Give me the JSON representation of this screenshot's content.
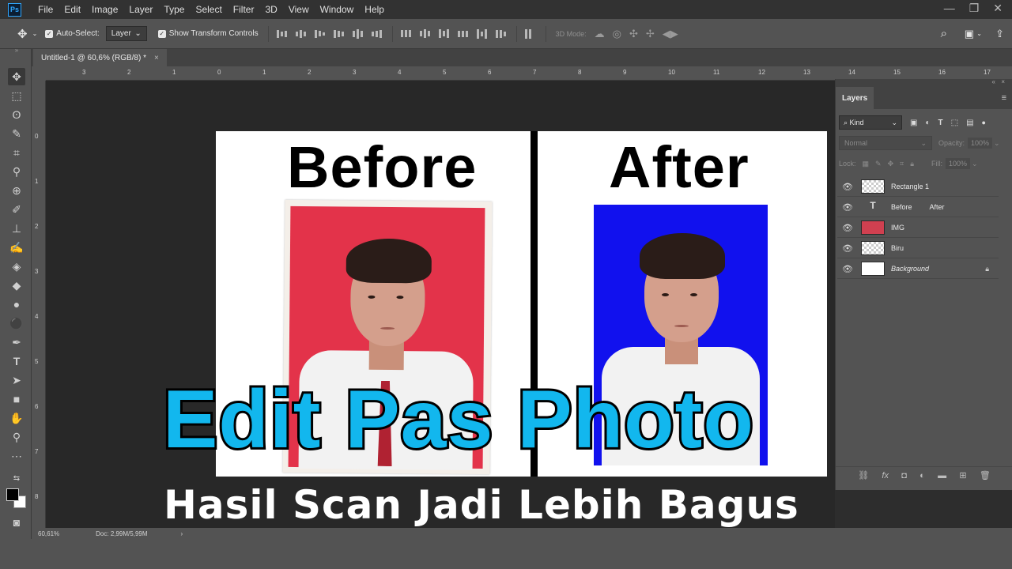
{
  "menubar": {
    "logo": "Ps",
    "items": [
      "File",
      "Edit",
      "Image",
      "Layer",
      "Type",
      "Select",
      "Filter",
      "3D",
      "View",
      "Window",
      "Help"
    ],
    "window_controls": [
      "—",
      "❐",
      "✕"
    ]
  },
  "options": {
    "auto_select_label": "Auto-Select:",
    "auto_select_value": "Layer",
    "show_transform_label": "Show Transform Controls",
    "mode_3d_label": "3D Mode:"
  },
  "document_tab": {
    "title": "Untitled-1 @ 60,6% (RGB/8) *",
    "close": "×"
  },
  "ruler_top": [
    "3",
    "2",
    "1",
    "0",
    "1",
    "2",
    "3",
    "4",
    "5",
    "6",
    "7",
    "8",
    "9",
    "10",
    "11",
    "12",
    "13",
    "14",
    "15",
    "16",
    "17"
  ],
  "ruler_left": [
    "0",
    "1",
    "2",
    "3",
    "4",
    "5",
    "6",
    "7",
    "8"
  ],
  "canvas": {
    "before_label": "Before",
    "after_label": "After",
    "title": "Edit Pas Photo",
    "subtitle": "Hasil Scan Jadi Lebih Bagus",
    "colors": {
      "title_fill": "#12b7ee",
      "before_bg": "#e3334a",
      "after_bg": "#1111ee"
    }
  },
  "layers_panel": {
    "tab_label": "Layers",
    "kind_label": "Kind",
    "blend_mode": "Normal",
    "opacity_label": "Opacity:",
    "opacity_value": "100%",
    "lock_label": "Lock:",
    "fill_label": "Fill:",
    "fill_value": "100%",
    "layers": [
      {
        "name": "Rectangle 1",
        "thumb": "checker"
      },
      {
        "name": "Before         After",
        "thumb": "type"
      },
      {
        "name": "IMG",
        "thumb": "red"
      },
      {
        "name": "Biru",
        "thumb": "checker"
      },
      {
        "name": "Background",
        "thumb": "white"
      }
    ]
  },
  "statusbar": {
    "zoom": "60,61%",
    "doc": "Doc: 2,99M/5,99M"
  }
}
